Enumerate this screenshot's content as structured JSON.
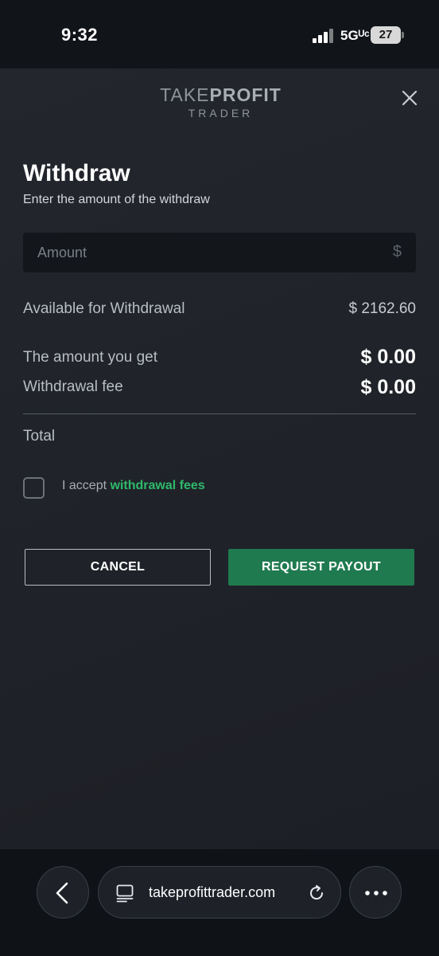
{
  "status_bar": {
    "time": "9:32",
    "network": "5Gᵁᶜ",
    "battery": "27"
  },
  "header": {
    "logo_take": "TAKE",
    "logo_profit": "PROFIT",
    "logo_sub": "TRADER",
    "close_icon": "close-icon"
  },
  "form": {
    "title": "Withdraw",
    "subtitle": "Enter the amount of the withdraw",
    "amount_placeholder": "Amount",
    "amount_value": "",
    "currency_symbol": "$",
    "available_label": "Available for Withdrawal",
    "available_value": "$ 2162.60",
    "amount_get_label": "The amount you get",
    "amount_get_value": "$ 0.00",
    "fee_label": "Withdrawal fee",
    "fee_value": "$ 0.00",
    "total_label": "Total",
    "accept_prefix": "I accept ",
    "accept_link": "withdrawal fees",
    "accept_checked": false
  },
  "buttons": {
    "cancel": "CANCEL",
    "request": "REQUEST PAYOUT"
  },
  "browser": {
    "url": "takeprofittrader.com",
    "back_icon": "chevron-left-icon",
    "reader_icon": "page-icon",
    "reload_icon": "reload-icon",
    "more_icon": "more-icon"
  },
  "colors": {
    "accent_green": "#2fb96c",
    "button_green": "#1f7a4f",
    "background": "#20232a"
  }
}
